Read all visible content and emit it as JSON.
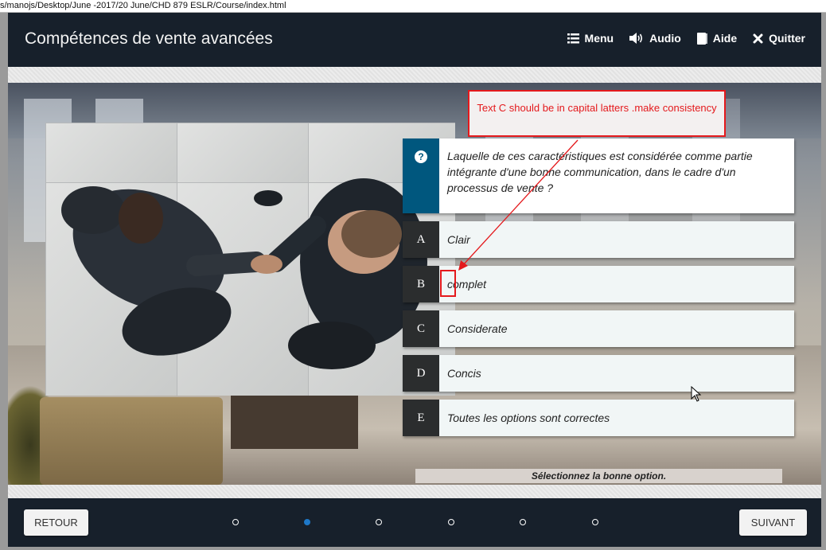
{
  "browser": {
    "path": "s/manojs/Desktop/June -2017/20 June/CHD 879 ESLR/Course/index.html"
  },
  "header": {
    "title": "Compétences de vente avancées",
    "nav": [
      {
        "label": "Menu",
        "icon": "menu-icon"
      },
      {
        "label": "Audio",
        "icon": "audio-icon"
      },
      {
        "label": "Aide",
        "icon": "help-icon"
      },
      {
        "label": "Quitter",
        "icon": "close-icon"
      }
    ]
  },
  "quiz": {
    "question": "Laquelle de ces caractéristiques est considérée comme partie intégrante d'une bonne communication, dans le cadre d'un processus de vente ?",
    "options": [
      {
        "letter": "A",
        "text": "Clair"
      },
      {
        "letter": "B",
        "text": "complet"
      },
      {
        "letter": "C",
        "text": "Considerate"
      },
      {
        "letter": "D",
        "text": "Concis"
      },
      {
        "letter": "E",
        "text": "Toutes les options sont correctes"
      }
    ],
    "instruction": "Sélectionnez la bonne option."
  },
  "annotation": {
    "text": "Text C should be in capital latters .make consistency",
    "color": "#e4191c"
  },
  "footer": {
    "back_label": "RETOUR",
    "next_label": "SUIVANT",
    "progress": {
      "total": 6,
      "current": 2
    }
  },
  "colors": {
    "header_bg": "#17202b",
    "question_badge": "#00577e",
    "letter_bg": "#2b2d2e",
    "active_dot": "#1e78c8"
  }
}
